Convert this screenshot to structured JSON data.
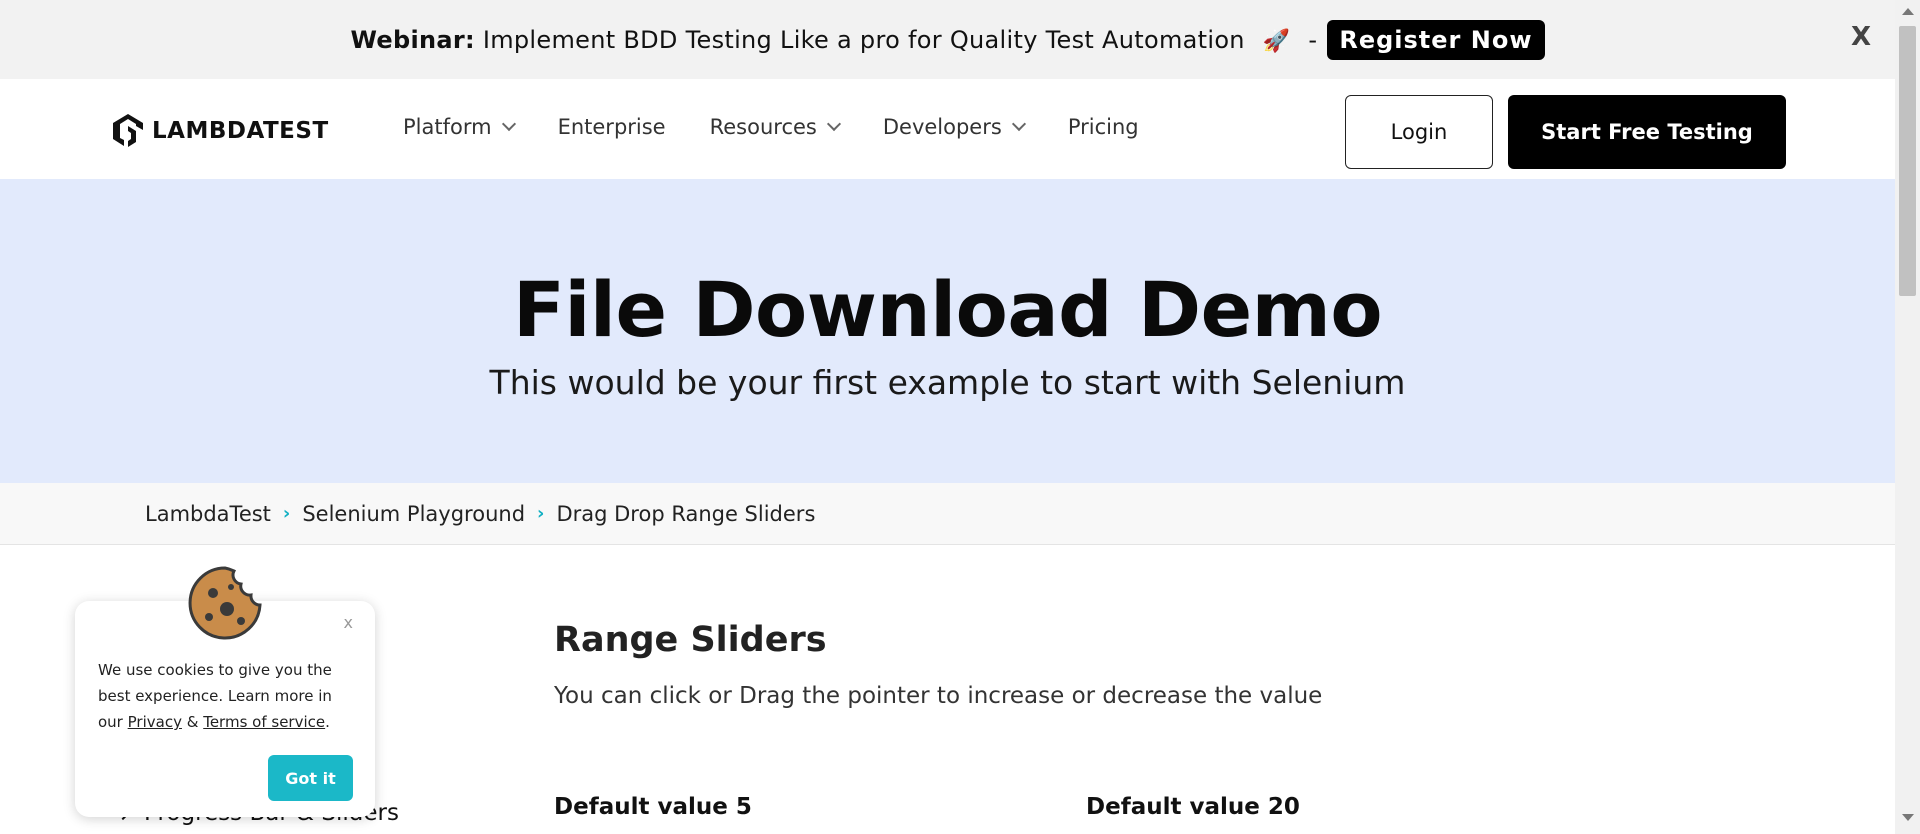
{
  "topbar": {
    "label_bold": "Webinar:",
    "message": "Implement BDD Testing Like a pro for Quality Test Automation",
    "rocket": "🚀",
    "dash": "-",
    "register": "Register Now",
    "close": "X"
  },
  "nav": {
    "logo_text": "LAMBDATEST",
    "menu": [
      "Platform",
      "Enterprise",
      "Resources",
      "Developers",
      "Pricing"
    ],
    "login": "Login",
    "start": "Start Free Testing"
  },
  "hero": {
    "title": "File Download Demo",
    "subtitle": "This would be your first example to start with Selenium"
  },
  "breadcrumb": [
    "LambdaTest",
    "Selenium Playground",
    "Drag Drop Range Sliders"
  ],
  "main": {
    "title": "Range Sliders",
    "description": "You can click or Drag the pointer to increase or decrease the value",
    "slider1_label": "Default value 5",
    "slider2_label": "Default value 20"
  },
  "sidebar": {
    "item": "Progress Bar & Sliders"
  },
  "cookie": {
    "close": "x",
    "text_1": "We use cookies to give you the best experience. Learn more in our",
    "privacy": "Privacy",
    "amp": "&",
    "terms": "Terms of service",
    "period": ".",
    "button": "Got it"
  },
  "colors": {
    "accent": "#12b0c3",
    "hero_bg": "#e2eafc",
    "cookie_button": "#1bb8c8"
  }
}
